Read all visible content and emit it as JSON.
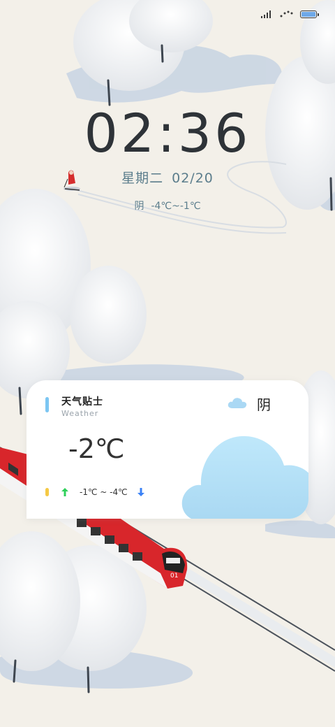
{
  "status_bar": {
    "icons": [
      "signal-icon",
      "wifi-icon",
      "battery-icon"
    ],
    "battery_color": "#6ea8e8"
  },
  "lockscreen": {
    "time": "02:36",
    "weekday": "星期二",
    "date": "02/20",
    "condition": "阴",
    "temp_range": "-4℃~-1℃"
  },
  "widget": {
    "title": "天气贴士",
    "subtitle": "Weather",
    "condition": "阴",
    "current_temp": "-2℃",
    "range": "-1℃ ~ -4℃",
    "icons": [
      "cloud-icon",
      "arrow-up-icon",
      "arrow-down-icon"
    ],
    "colors": {
      "accent": "#7cc6f2",
      "up": "#2fd05a",
      "down": "#3b82f6",
      "cloud": "#b9e2f7",
      "pill": "#f5c945"
    }
  },
  "wallpaper": {
    "train_number": "01"
  }
}
